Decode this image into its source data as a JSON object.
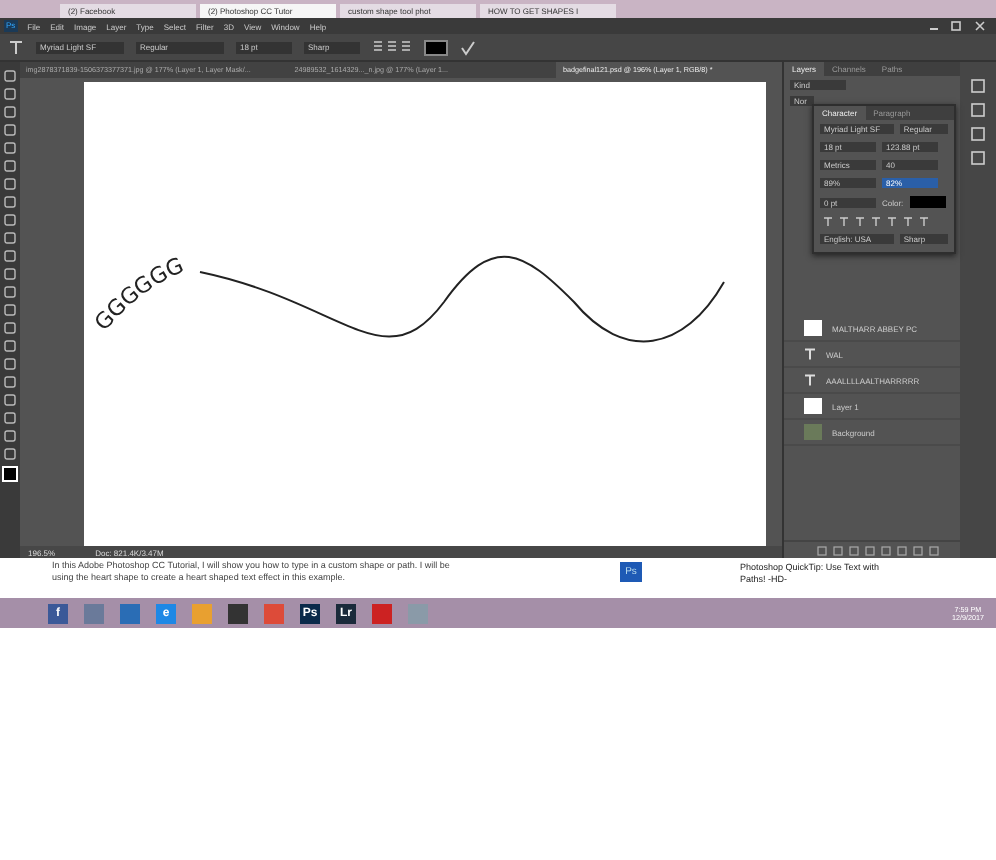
{
  "browser_tabs": [
    {
      "label": "(2) Facebook",
      "selected": false
    },
    {
      "label": "(2) Photoshop CC Tutor",
      "selected": true
    },
    {
      "label": "custom shape tool phot",
      "selected": false
    },
    {
      "label": "HOW TO GET SHAPES I",
      "selected": false
    }
  ],
  "app": {
    "logo": "Ps",
    "menu": [
      "File",
      "Edit",
      "Image",
      "Layer",
      "Type",
      "Select",
      "Filter",
      "3D",
      "View",
      "Window",
      "Help"
    ]
  },
  "options": {
    "font": "Myriad Light SF",
    "style": "Regular",
    "size": "18 pt",
    "antialias": "Sharp"
  },
  "doc_tabs": [
    {
      "label": "img2878371839-1506373377371.jpg @ 177% (Layer 1, Layer Mask/...",
      "selected": false
    },
    {
      "label": "24989532_1614329..._n.jpg @ 177% (Layer 1...",
      "selected": false
    },
    {
      "label": "badgefinal121.psd @ 196% (Layer 1, RGB/8) *",
      "selected": true
    }
  ],
  "canvas": {
    "path_text": "GGGGGG"
  },
  "status_bar": {
    "zoom": "196.5%",
    "doc": "Doc: 821.4K/3.47M"
  },
  "layers_panel": {
    "tabs": [
      {
        "label": "Layers",
        "selected": true
      },
      {
        "label": "Channels",
        "selected": false
      },
      {
        "label": "Paths",
        "selected": false
      }
    ],
    "kind": "Kind",
    "blend": "Nor",
    "layers": [
      {
        "kind": "text",
        "name": "WAL"
      },
      {
        "kind": "text",
        "name": "AAALLLLAALTHARRRRR"
      },
      {
        "kind": "image",
        "name": "Layer 1"
      },
      {
        "kind": "background",
        "name": "Background"
      }
    ],
    "top_layer": "MALTHARR ABBEY PC"
  },
  "character_panel": {
    "tabs": [
      {
        "label": "Character",
        "selected": true
      },
      {
        "label": "Paragraph",
        "selected": false
      }
    ],
    "font": "Myriad Light SF",
    "style": "Regular",
    "size": "18 pt",
    "leading": "123.88 pt",
    "kerning": "Metrics",
    "tracking": "40",
    "vscale": "89%",
    "hscale": "82%",
    "baseline": "0 pt",
    "color_label": "Color:",
    "language": "English: USA",
    "antialias": "Sharp"
  },
  "webpage": {
    "text": "In this Adobe Photoshop CC Tutorial, I will show you how to type in a custom shape or path. I will be using the heart shape to create a heart shaped text effect in this example.",
    "video_thumb": "Ps",
    "video_title": "Photoshop QuickTip: Use Text with Paths! -HD-"
  },
  "taskbar": {
    "apps": [
      {
        "label": "f",
        "color": "#3b5998"
      },
      {
        "color": "#6a7a9a"
      },
      {
        "color": "#2a6db5"
      },
      {
        "label": "e",
        "color": "#1e88e5"
      },
      {
        "color": "#e8a030"
      },
      {
        "color": "#333333"
      },
      {
        "color": "#dd4b39"
      },
      {
        "label": "Ps",
        "color": "#0a2a4a"
      },
      {
        "label": "Lr",
        "color": "#1a2a3a"
      },
      {
        "color": "#cc2222"
      },
      {
        "color": "#8a9aa8"
      }
    ],
    "time": "7:59 PM",
    "date": "12/9/2017"
  }
}
